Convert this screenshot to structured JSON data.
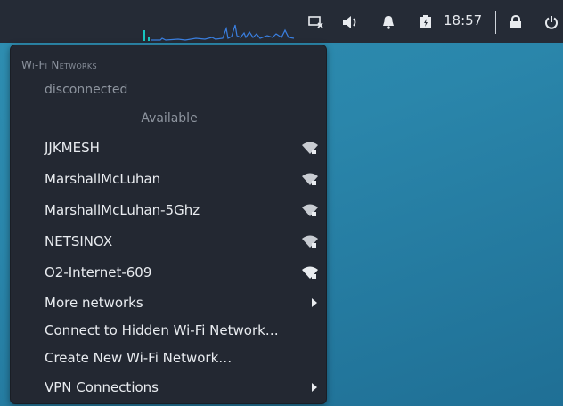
{
  "topbar": {
    "clock": "18:57",
    "icons": [
      "window-close-icon",
      "volume-icon",
      "bell-icon",
      "battery-icon",
      "lock-icon",
      "power-icon"
    ]
  },
  "wifi_menu": {
    "title": "Wi-Fi Networks",
    "status": "disconnected",
    "available_label": "Available",
    "networks": [
      {
        "name": "JJKMESH",
        "icon": "wifi-signal-icon"
      },
      {
        "name": "MarshallMcLuhan",
        "icon": "wifi-signal-icon"
      },
      {
        "name": "MarshallMcLuhan-5Ghz",
        "icon": "wifi-signal-icon"
      },
      {
        "name": "NETSINOX",
        "icon": "wifi-signal-icon"
      },
      {
        "name": "O2-Internet-609",
        "icon": "wifi-signal-icon"
      }
    ],
    "more_networks": "More networks",
    "connect_hidden": "Connect to Hidden Wi-Fi Network…",
    "create_new": "Create New Wi-Fi Network…",
    "vpn": "VPN Connections"
  },
  "colors": {
    "panel": "#232832",
    "topbar": "#252b36",
    "desktop": "#2a86ab",
    "graph_accent": "#17c6c0",
    "graph_line": "#3a7fe0"
  }
}
